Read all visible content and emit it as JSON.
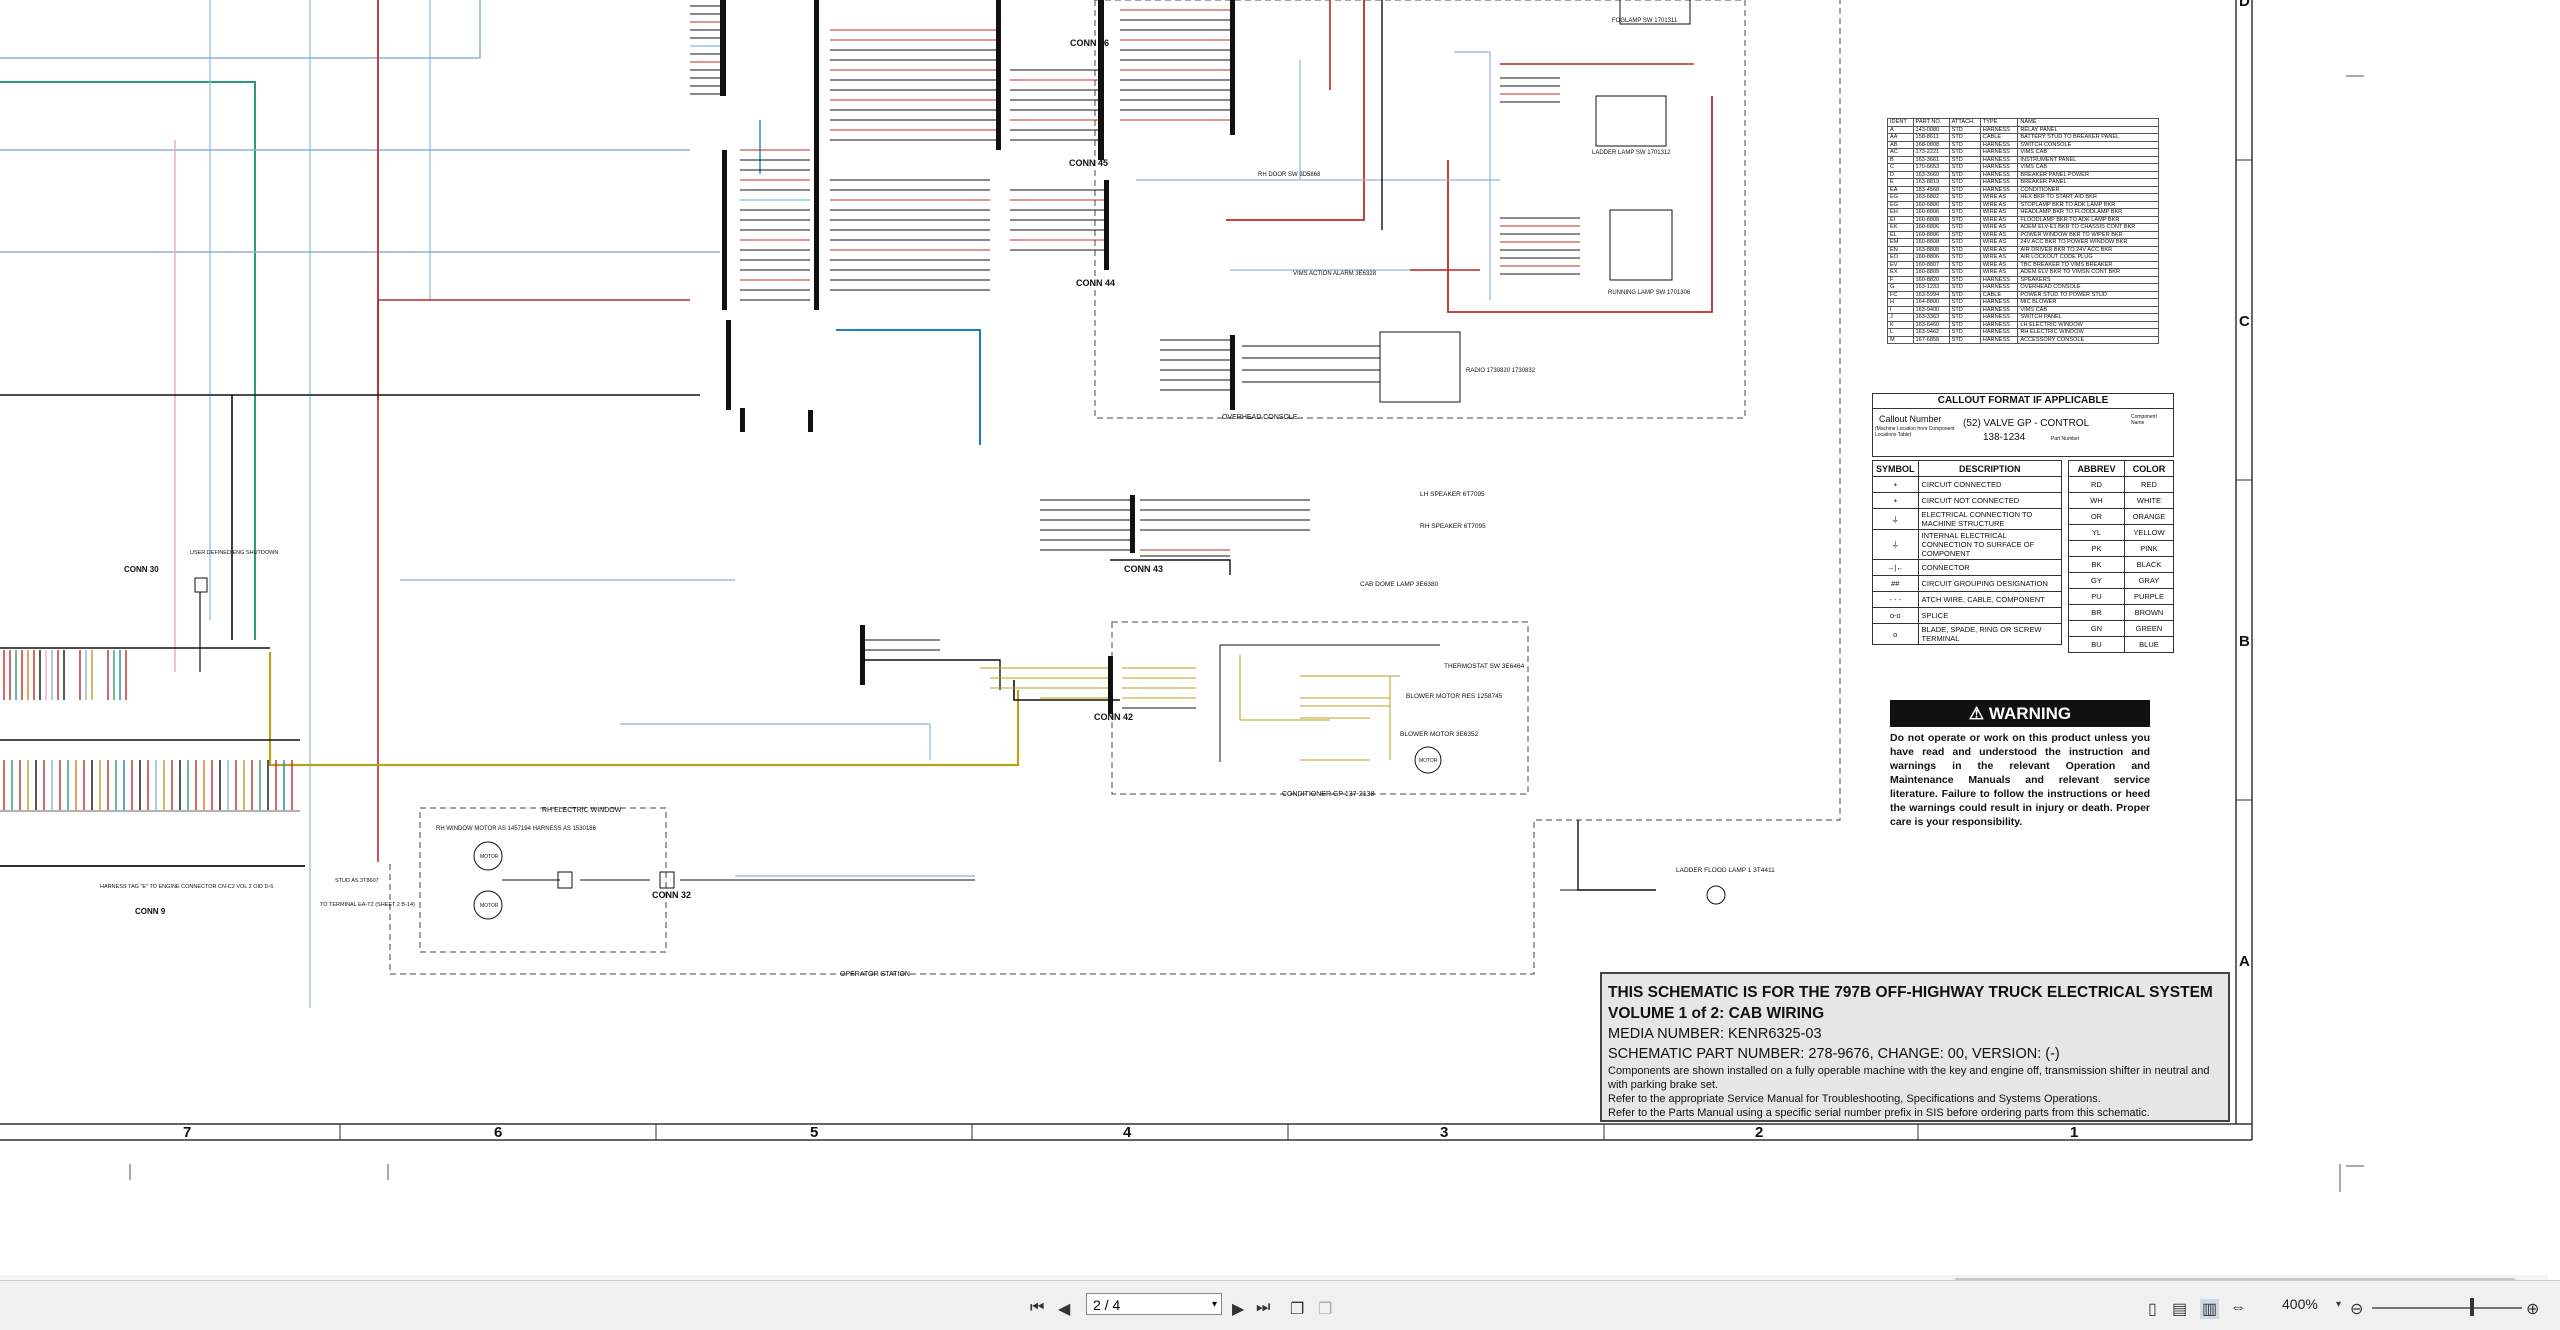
{
  "title_block": {
    "line1": "THIS SCHEMATIC IS FOR THE 797B OFF-HIGHWAY TRUCK ELECTRICAL SYSTEM",
    "line2": "VOLUME 1 of 2: CAB WIRING",
    "line3": "MEDIA NUMBER: KENR6325-03",
    "line4": "SCHEMATIC PART NUMBER: 278-9676, CHANGE: 00, VERSION: (-)",
    "line5": "Components are shown installed on a fully operable machine with the key and engine off, transmission shifter in neutral and with parking brake set.",
    "line6": "Refer to the appropriate Service Manual for Troubleshooting, Specifications and Systems Operations.",
    "line7": "Refer to the Parts Manual using a specific serial number prefix in SIS before ordering parts from this schematic."
  },
  "warning": {
    "title": "WARNING",
    "text": "Do not operate or work on this product unless you have read and understood the instruction and warnings in the relevant Operation and Maintenance Manuals and relevant service literature. Failure to follow the instructions or heed the warnings could result in injury or death. Proper care is your responsibility."
  },
  "callout": {
    "title": "CALLOUT FORMAT IF APPLICABLE",
    "callout_number": "Callout Number",
    "callout_sub": "(Machine Location from Component Locations Table)",
    "example": "(52) VALVE GP - CONTROL",
    "part": "138-1234",
    "component_name": "Component Name",
    "part_number": "Part Number"
  },
  "symbols": {
    "header_symbol": "SYMBOL",
    "header_desc": "DESCRIPTION",
    "rows": [
      {
        "icon": "+",
        "desc": "CIRCUIT CONNECTED"
      },
      {
        "icon": "+",
        "desc": "CIRCUIT NOT CONNECTED"
      },
      {
        "icon": "⏚",
        "desc": "ELECTRICAL CONNECTION TO MACHINE STRUCTURE"
      },
      {
        "icon": "⏚",
        "desc": "INTERNAL ELECTRICAL CONNECTION TO SURFACE OF COMPONENT"
      },
      {
        "icon": "→|←",
        "desc": "CONNECTOR"
      },
      {
        "icon": "##",
        "desc": "CIRCUIT GROUPING DESIGNATION"
      },
      {
        "icon": "- - -",
        "desc": "ATCH WIRE, CABLE, COMPONENT"
      },
      {
        "icon": "o-o",
        "desc": "SPLICE"
      },
      {
        "icon": "o",
        "desc": "BLADE, SPADE, RING OR SCREW TERMINAL"
      }
    ]
  },
  "colors": {
    "header_abbrev": "ABBREV",
    "header_color": "COLOR",
    "rows": [
      {
        "abbrev": "RD",
        "color": "RED"
      },
      {
        "abbrev": "WH",
        "color": "WHITE"
      },
      {
        "abbrev": "OR",
        "color": "ORANGE"
      },
      {
        "abbrev": "YL",
        "color": "YELLOW"
      },
      {
        "abbrev": "PK",
        "color": "PINK"
      },
      {
        "abbrev": "BK",
        "color": "BLACK"
      },
      {
        "abbrev": "GY",
        "color": "GRAY"
      },
      {
        "abbrev": "PU",
        "color": "PURPLE"
      },
      {
        "abbrev": "BR",
        "color": "BROWN"
      },
      {
        "abbrev": "GN",
        "color": "GREEN"
      },
      {
        "abbrev": "BU",
        "color": "BLUE"
      }
    ]
  },
  "component_table": {
    "headers": [
      "IDENT",
      "PART NO.",
      "ATTACH",
      "TYPE",
      "NAME"
    ],
    "rows": [
      [
        "A",
        "143-0080",
        "STD",
        "HARNESS",
        "RELAY PANEL"
      ],
      [
        "AA",
        "158-8611",
        "STD",
        "CABLE",
        "BATTERY STUD TO BREAKER PANEL"
      ],
      [
        "AB",
        "168-0808",
        "STD",
        "HARNESS",
        "SWITCH CONSOLE"
      ],
      [
        "AC",
        "173-2221",
        "STD",
        "HARNESS",
        "VIMS CAB"
      ],
      [
        "B",
        "163-3661",
        "STD",
        "HARNESS",
        "INSTRUMENT PANEL"
      ],
      [
        "C",
        "170-6653",
        "STD",
        "HARNESS",
        "VIMS CAB"
      ],
      [
        "D",
        "163-3660",
        "STD",
        "HARNESS",
        "BREAKER PANEL POWER"
      ],
      [
        "E",
        "163-8819",
        "STD",
        "HARNESS",
        "BREAKER PANEL"
      ],
      [
        "EA",
        "183-4568",
        "STD",
        "HARNESS",
        "CONDITIONER"
      ],
      [
        "EG",
        "163-6802",
        "STD",
        "WIRE AS",
        "HEX BKR TO START AID BKR"
      ],
      [
        "EG",
        "160-6806",
        "STD",
        "WIRE AS",
        "STOPLAMP BKR TO ADK LAMP BKR"
      ],
      [
        "EH",
        "160-8806",
        "STD",
        "WIRE AS",
        "HEADLAMP BKR TO FLOODLAMP BKR"
      ],
      [
        "EI",
        "160-8808",
        "STD",
        "WIRE AS",
        "FLOODLAMP BKR TO ADK LAMP BKR"
      ],
      [
        "EK",
        "160-6806",
        "STD",
        "WIRE AS",
        "ADEM ELV-E1 BKR TO CHASSIS CONT BKR"
      ],
      [
        "EL",
        "160-8806",
        "STD",
        "WIRE AS",
        "POWER WINDOW BKR TO WIPER BKR"
      ],
      [
        "EM",
        "160-8808",
        "STD",
        "WIRE AS",
        "24V ACC BKR TO POWER WINDOW BKR"
      ],
      [
        "EN",
        "163-8808",
        "STD",
        "WIRE AS",
        "AIR DRIVER BKR TO 24V ACC BKR"
      ],
      [
        "EO",
        "160-8806",
        "STD",
        "WIRE AS",
        "AIR LOCKOUT CODE PLUG"
      ],
      [
        "EV",
        "160-8807",
        "STD",
        "WIRE AS",
        "TBC BREAKER TO VIMS BREAKER"
      ],
      [
        "EX",
        "160-8809",
        "STD",
        "WIRE AS",
        "ADEM ELV BKR TO VIMSN CONT BKR"
      ],
      [
        "F",
        "160-8820",
        "STD",
        "HARNESS",
        "SPEAKERS"
      ],
      [
        "G",
        "163-1233",
        "STD",
        "HARNESS",
        "OVERHEAD CONSOLE"
      ],
      [
        "FC",
        "163-5994",
        "STD",
        "CABLE",
        "POWER STUD TO POWER STUD"
      ],
      [
        "H",
        "164-8800",
        "STD",
        "HARNESS",
        "MIC BLOWER"
      ],
      [
        "I",
        "163-9400",
        "STD",
        "HARNESS",
        "VIMS CAB"
      ],
      [
        "J",
        "163-3363",
        "STD",
        "HARNESS",
        "SWITCH PANEL"
      ],
      [
        "K",
        "163-6460",
        "STD",
        "HARNESS",
        "LH ELECTRIC WINDOW"
      ],
      [
        "L",
        "163-9462",
        "STD",
        "HARNESS",
        "RH ELECTRIC WINDOW"
      ],
      [
        "M",
        "167-6858",
        "STD",
        "HARNESS",
        "ACCESSORY CONSOLE"
      ]
    ]
  },
  "zones": {
    "columns": [
      "7",
      "6",
      "5",
      "4",
      "3",
      "2",
      "1"
    ],
    "rows": [
      "D",
      "C",
      "B",
      "A"
    ]
  },
  "components": {
    "conn46": "CONN 46",
    "conn45": "CONN 45",
    "conn44": "CONN 44",
    "conn43": "CONN 43",
    "conn42": "CONN 42",
    "conn32": "CONN 32",
    "conn30": "CONN 30",
    "conn9": "CONN 9",
    "conn9_desc": "HARNESS TAG \"E\" TO ENGINE CONNECTOR CN-C2 VOL 2 OID D-6",
    "conn30_desc": "USER DEFINED ENG SHUTDOWN",
    "terminal": "TO TERMINAL EA-T2 (SHEET 2 B-14)",
    "stud": "STUD AS 3T8607",
    "floodlamp_sw": "FOGLAMP SW 1701311",
    "ladder_lamp_sw": "LADDER LAMP SW 1701312",
    "running_lamp_sw": "RUNNING LAMP SW 1701306",
    "rh_door_sw": "RH DOOR SW 3D5868",
    "vims_alarm": "VIMS ACTION ALARM 3E6328",
    "radio": "RADIO 1730820 1730832",
    "overhead_console": "OVERHEAD CONSOLE",
    "lh_speaker": "LH SPEAKER 6T7095",
    "rh_speaker": "RH SPEAKER 6T7095",
    "cab_dome_lamp": "CAB DOME LAMP 3E6380",
    "thermostat_sw": "THERMOSTAT SW 3E6464",
    "blower_motor_res": "BLOWER MOTOR RES 1258745",
    "blower_motor": "BLOWER MOTOR 3E6352",
    "conditioner": "CONDITIONER GP 137-2138",
    "operator_station": "OPERATOR STATION",
    "rh_electric_window": "RH ELECTRIC WINDOW",
    "rh_window_motor": "RH WINDOW MOTOR AS 1457194 HARNESS AS 1530186",
    "ladder_flood_lamp": "LADDER FLOOD LAMP 1 3T4411",
    "motor": "MOTOR"
  },
  "viewer": {
    "page_value": "2 / 4",
    "zoom": "400%"
  }
}
